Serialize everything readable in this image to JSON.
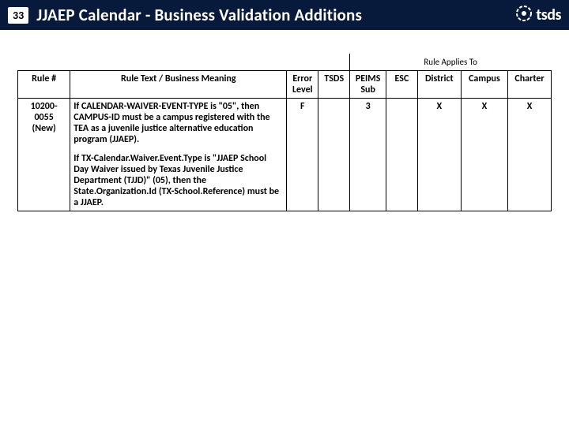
{
  "header": {
    "page_number": "33",
    "title": "JJAEP Calendar  - Business Validation Additions",
    "logo_text": "tsds"
  },
  "table": {
    "applies_label": "Rule Applies To",
    "columns": {
      "rule_num": "Rule #",
      "rule_text": "Rule Text / Business Meaning",
      "error_level": "Error Level",
      "tsds": "TSDS",
      "peims_sub": "PEIMS Sub",
      "esc": "ESC",
      "district": "District",
      "campus": "Campus",
      "charter": "Charter"
    },
    "rows": [
      {
        "rule_num": "10200-0055 (New)",
        "para1": "If CALENDAR-WAIVER-EVENT-TYPE is \"05\", then CAMPUS-ID must be a campus registered with the TEA as a juvenile justice alternative education program (JJAEP).",
        "para2": "If TX-Calendar.Waiver.Event.Type is \"JJAEP School Day Waiver issued by Texas Juvenile Justice Department (TJJD)\" (05), then the State.Organization.Id (TX-School.Reference) must be a JJAEP.",
        "error_level": "F",
        "tsds": "",
        "peims_sub": "3",
        "esc": "",
        "district": "X",
        "campus": "X",
        "charter": "X"
      }
    ]
  }
}
